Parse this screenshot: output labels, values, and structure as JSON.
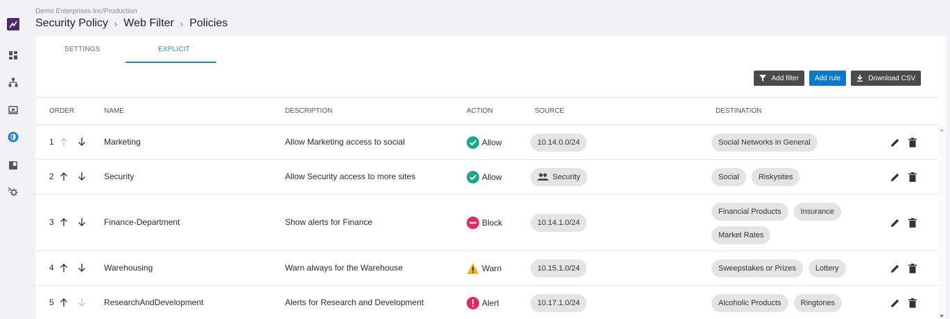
{
  "breadcrumb": {
    "org": "Demo Enterprises Inc/Production",
    "parts": [
      "Security Policy",
      "Web Filter",
      "Policies"
    ],
    "separator": "›"
  },
  "tabs": [
    {
      "label": "SETTINGS",
      "active": false
    },
    {
      "label": "EXPLICIT",
      "active": true
    }
  ],
  "toolbar": {
    "add_filter": "Add filter",
    "add_rule": "Add rule",
    "download_csv": "Download CSV"
  },
  "columns": {
    "order": "ORDER",
    "name": "NAME",
    "description": "DESCRIPTION",
    "action": "ACTION",
    "source": "SOURCE",
    "destination": "DESTINATION"
  },
  "rows": [
    {
      "order": "1",
      "up_enabled": false,
      "down_enabled": true,
      "name": "Marketing",
      "description": "Allow Marketing access to social",
      "action": "Allow",
      "action_icon": "check-circle-icon",
      "source": "10.14.0.0/24",
      "source_icon": "",
      "destinations": [
        "Social Networks in General"
      ]
    },
    {
      "order": "2",
      "up_enabled": true,
      "down_enabled": true,
      "name": "Security",
      "description": "Allow Security access to more sites",
      "action": "Allow",
      "action_icon": "check-circle-icon",
      "source": "Security",
      "source_icon": "group-icon",
      "destinations": [
        "Social",
        "Riskysites"
      ]
    },
    {
      "order": "3",
      "up_enabled": true,
      "down_enabled": true,
      "name": "Finance-Department",
      "description": "Show alerts for Finance",
      "action": "Block",
      "action_icon": "block-icon",
      "source": "10.14.1.0/24",
      "source_icon": "",
      "destinations": [
        "Financial Products",
        "Insurance",
        "Market Rates"
      ]
    },
    {
      "order": "4",
      "up_enabled": true,
      "down_enabled": true,
      "name": "Warehousing",
      "description": "Warn always for the Warehouse",
      "action": "Warn",
      "action_icon": "warning-icon",
      "source": "10.15.1.0/24",
      "source_icon": "",
      "destinations": [
        "Sweepstakes or Prizes",
        "Lottery"
      ]
    },
    {
      "order": "5",
      "up_enabled": true,
      "down_enabled": false,
      "name": "ResearchAndDevelopment",
      "description": "Alerts for Research and Development",
      "action": "Alert",
      "action_icon": "alert-icon",
      "source": "10.17.1.0/24",
      "source_icon": "",
      "destinations": [
        "Alcoholic Products",
        "Ringtones"
      ]
    }
  ],
  "colors": {
    "accent": "#1e88c9",
    "allow": "#1aa88a",
    "block": "#e8285a",
    "warn": "#f5b21b",
    "alert": "#e8285a",
    "logo": "#4b2a6b"
  },
  "sidebar_icons": [
    "dashboard-icon",
    "network-icon",
    "devices-icon",
    "security-shield-icon",
    "reports-icon",
    "settings-icon"
  ]
}
